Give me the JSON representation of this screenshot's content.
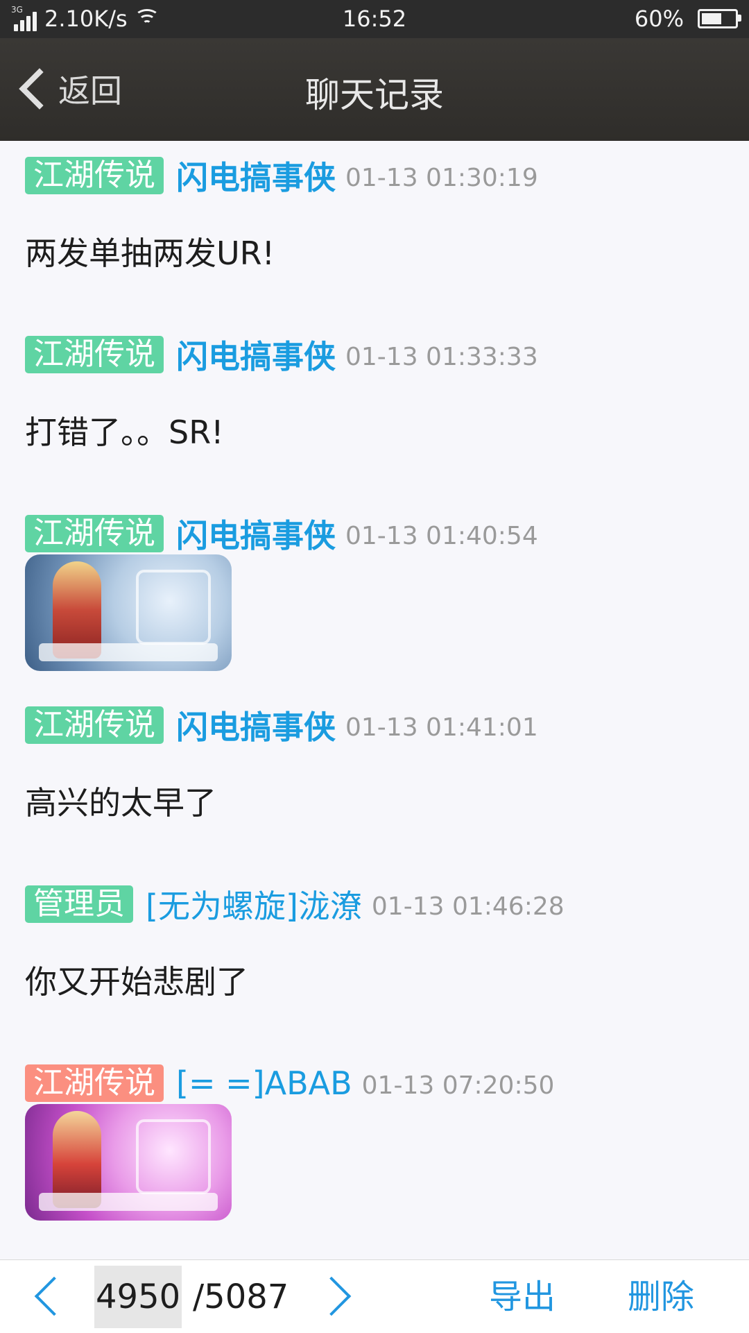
{
  "status_bar": {
    "network_type": "3G",
    "speed": "2.10K/s",
    "time": "16:52",
    "battery": "60%",
    "battery_level": 0.6
  },
  "header": {
    "back_label": "返回",
    "title": "聊天记录"
  },
  "messages": [
    {
      "badge": "江湖传说",
      "badge_color": "#5fd4a3",
      "name": "闪电搞事侠",
      "time": "01-13 01:30:19",
      "text": "两发单抽两发UR!"
    },
    {
      "badge": "江湖传说",
      "badge_color": "#5fd4a3",
      "name": "闪电搞事侠",
      "time": "01-13 01:33:33",
      "text": "打错了。。SR!"
    },
    {
      "badge": "江湖传说",
      "badge_color": "#5fd4a3",
      "name": "闪电搞事侠",
      "time": "01-13 01:40:54",
      "image": "card-screenshot-blue"
    },
    {
      "badge": "江湖传说",
      "badge_color": "#5fd4a3",
      "name": "闪电搞事侠",
      "time": "01-13 01:41:01",
      "text": "高兴的太早了"
    },
    {
      "badge": "管理员",
      "badge_color": "#5fd4a3",
      "name": "[无为螺旋]泷潦",
      "time": "01-13 01:46:28",
      "text": "你又开始悲剧了"
    },
    {
      "badge": "江湖传说",
      "badge_color": "#fb8f80",
      "name": "[= =]ABAB",
      "time": "01-13 07:20:50",
      "image": "card-screenshot-purple"
    }
  ],
  "toolbar": {
    "current_page": "4950",
    "total_pages": "/5087",
    "export_label": "导出",
    "delete_label": "删除",
    "prev_icon": "chevron-left-icon",
    "next_icon": "chevron-right-icon",
    "accent_color": "#2196e0"
  }
}
